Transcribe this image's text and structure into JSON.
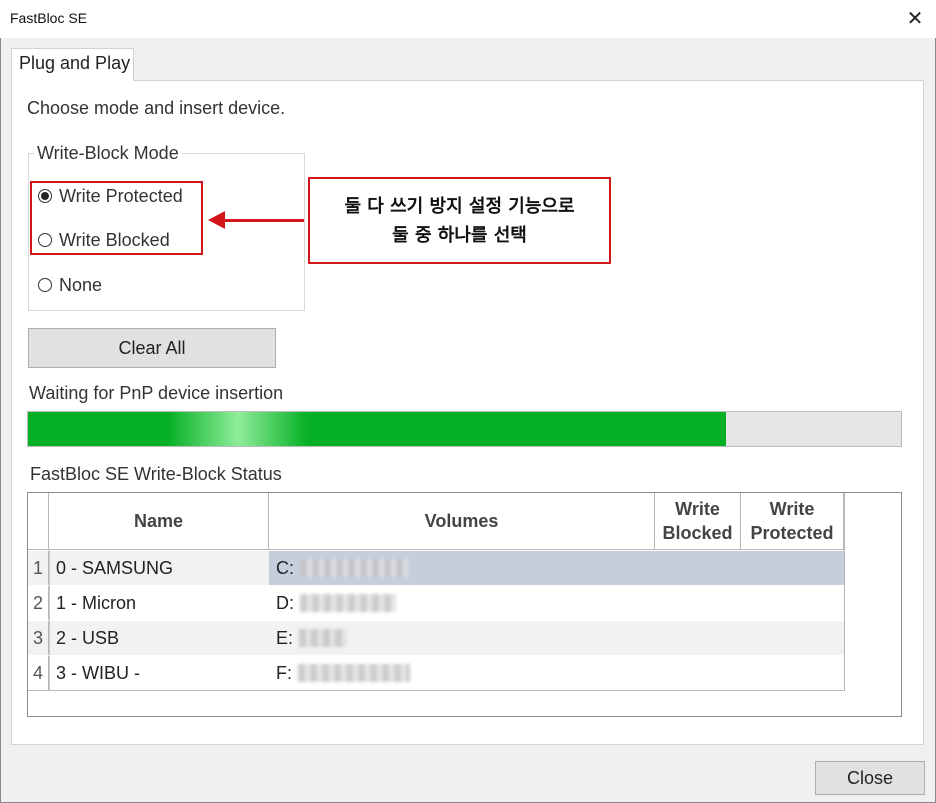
{
  "window": {
    "title": "FastBloc SE",
    "close_glyph": "✕"
  },
  "tab": {
    "label": "Plug and Play"
  },
  "instruction": "Choose mode and insert device.",
  "write_block_mode": {
    "legend": "Write-Block Mode",
    "options": [
      {
        "label": "Write Protected",
        "checked": true
      },
      {
        "label": "Write Blocked",
        "checked": false
      },
      {
        "label": "None",
        "checked": false
      }
    ]
  },
  "annotation": {
    "line1": "둘 다 쓰기 방지 설정 기능으로",
    "line2": "둘 중 하나를 선택",
    "color": "#d3161b"
  },
  "clear_all_label": "Clear All",
  "progress": {
    "label": "Waiting for PnP device insertion",
    "percent": 80,
    "color": "#06b025"
  },
  "status": {
    "label": "FastBloc SE Write-Block Status",
    "columns": {
      "name": "Name",
      "volumes": "Volumes",
      "write_blocked": "Write Blocked",
      "write_protected": "Write Protected"
    },
    "rows": [
      {
        "num": "1",
        "name": "0 - SAMSUNG",
        "volume": "C:",
        "selected": true
      },
      {
        "num": "2",
        "name": "1 - Micron",
        "volume": "D:",
        "selected": false
      },
      {
        "num": "3",
        "name": "2 - USB",
        "volume": "E:",
        "selected": false
      },
      {
        "num": "4",
        "name": "3 - WIBU -",
        "volume": "F:",
        "selected": false
      }
    ],
    "selected_color": "#c5cfdb",
    "alt_row_color": "#f2f2f2"
  },
  "close_button_label": "Close"
}
